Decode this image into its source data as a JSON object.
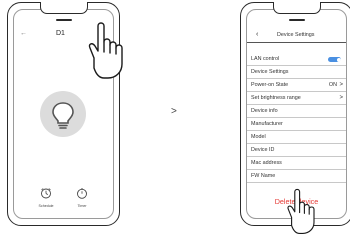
{
  "left_phone": {
    "title": "D1",
    "back_icon": "back-arrow-icon",
    "more_icon": "more-dots-icon",
    "bulb_icon": "light-bulb-icon",
    "bottom": [
      {
        "label": "Schedule",
        "icon": "alarm-clock-icon"
      },
      {
        "label": "Timer",
        "icon": "stopwatch-icon"
      }
    ]
  },
  "arrow": ">",
  "right_phone": {
    "header_title": "Device Settings",
    "lan_control": {
      "label": "LAN  control",
      "enabled": true,
      "accent": "#4a90e2"
    },
    "rows": [
      {
        "label": "Device Settings",
        "value": "",
        "chevron": false
      },
      {
        "label": "Power-on State",
        "value": "ON",
        "chevron": true
      },
      {
        "label": "Set brightness range",
        "value": "",
        "chevron": true
      },
      {
        "label": "Device info",
        "value": "",
        "chevron": false
      },
      {
        "label": "Manufacturer",
        "value": "",
        "chevron": false
      },
      {
        "label": "Model",
        "value": "",
        "chevron": false
      },
      {
        "label": "Device ID",
        "value": "",
        "chevron": false
      },
      {
        "label": "Mac address",
        "value": "",
        "chevron": false
      },
      {
        "label": "FW Name",
        "value": "",
        "chevron": false
      }
    ],
    "delete_label": "Delete device",
    "delete_color": "#e53935"
  }
}
